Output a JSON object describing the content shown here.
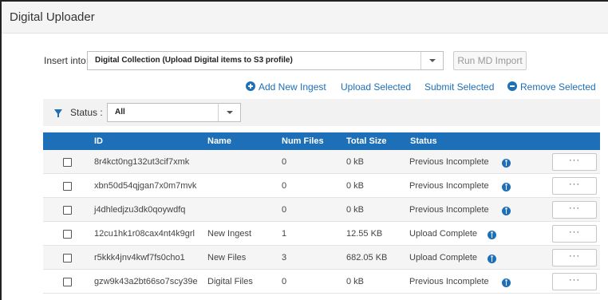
{
  "title": "Digital Uploader",
  "insert": {
    "label": "Insert into:",
    "selected": "Digital Collection (Upload Digital items to S3 profile)",
    "run_button": "Run MD Import"
  },
  "actions": {
    "add": "Add New Ingest",
    "upload": "Upload Selected",
    "submit": "Submit Selected",
    "remove": "Remove Selected"
  },
  "filter": {
    "label": "Status :",
    "selected": "All"
  },
  "table": {
    "columns": [
      "ID",
      "Name",
      "Num Files",
      "Total Size",
      "Status"
    ],
    "rows": [
      {
        "id": "8r4kct0ng132ut3cif7xmk",
        "name": "",
        "num_files": "0",
        "size": "0 kB",
        "status": "Previous Incomplete",
        "more": "···"
      },
      {
        "id": "xbn50d54qjgan7x0m7mvk",
        "name": "",
        "num_files": "0",
        "size": "0 kB",
        "status": "Previous Incomplete",
        "more": "···"
      },
      {
        "id": "j4dhledjzu3dk0qoywdfq",
        "name": "",
        "num_files": "0",
        "size": "0 kB",
        "status": "Previous Incomplete",
        "more": "···"
      },
      {
        "id": "12cu1hk1r08cax4nt4k9grl",
        "name": "New Ingest",
        "num_files": "1",
        "size": "12.55 KB",
        "status": "Upload Complete",
        "more": "···"
      },
      {
        "id": "r5kkk4jnv4kwf7fs0cho1",
        "name": "New Files",
        "num_files": "3",
        "size": "682.05 KB",
        "status": "Upload Complete",
        "more": "···"
      },
      {
        "id": "gzw9k43a2bt66so7scy39e",
        "name": "Digital Files",
        "num_files": "0",
        "size": "0 kB",
        "status": "Previous Incomplete",
        "more": "···"
      }
    ]
  },
  "colors": {
    "accent": "#1d6fb8",
    "header_bg": "#f4f4f4"
  }
}
